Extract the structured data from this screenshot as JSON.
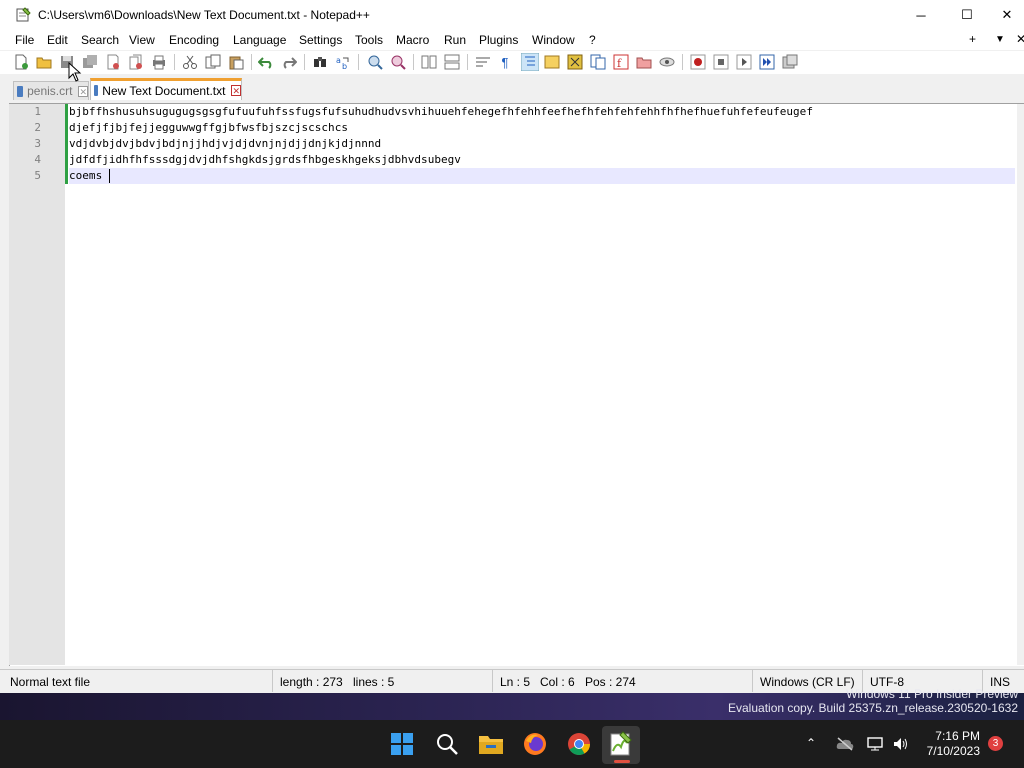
{
  "window": {
    "title": "C:\\Users\\vm6\\Downloads\\New Text Document.txt - Notepad++",
    "minimize_glyph": "─",
    "maximize_glyph": "☐",
    "close_glyph": "✕"
  },
  "menu": {
    "items": [
      "File",
      "Edit",
      "Search",
      "View",
      "Encoding",
      "Language",
      "Settings",
      "Tools",
      "Macro",
      "Run",
      "Plugins",
      "Window",
      "?"
    ],
    "right": [
      "+",
      "▼",
      "✕"
    ]
  },
  "tabs": [
    {
      "label": "penis.crt",
      "active": false
    },
    {
      "label": "New Text Document.txt",
      "active": true
    }
  ],
  "editor": {
    "line_numbers": [
      "1",
      "2",
      "3",
      "4",
      "5"
    ],
    "lines": [
      "bjbffhshusuhsugugugsgsgfufuufuhfssfugsfufsuhudhudvsvhihuuehfehegefhfehhfeefhefhfehfehfehhfhfhefhuefuhfefeufeugef",
      "djefjfjbjfejjegguwwgffgjbfwsfbjszcjscschcs",
      "vdjdvbjdvjbdvjbdjnjjhdjvjdjdvnjnjdjjdnjkjdjnnnd",
      "jdfdfjidhfhfsssdgjdvjdhfshgkdsjgrdsfhbgeskhgeksjdbhvdsubegv",
      "coems"
    ],
    "current_line": 5
  },
  "status": {
    "file_type": "Normal text file",
    "length": "length : 273",
    "lines": "lines : 5",
    "ln": "Ln : 5",
    "col": "Col : 6",
    "pos": "Pos : 274",
    "eol": "Windows (CR LF)",
    "encoding": "UTF-8",
    "mode": "INS"
  },
  "desktop": {
    "watermark_line1": "Windows 11 Pro Insider Preview",
    "watermark_line2": "Evaluation copy. Build 25375.zn_release.230520-1632"
  },
  "taskbar": {
    "apps": [
      "start-icon",
      "search-icon",
      "file-explorer-icon",
      "firefox-icon",
      "chrome-icon",
      "notepadpp-icon"
    ],
    "time": "7:16 PM",
    "date": "7/10/2023",
    "notification_count": "3"
  },
  "colors": {
    "tab_accent": "#f0a030",
    "change_bar": "#2ea043",
    "current_line": "#e8e8ff",
    "taskbar": "#1c1c1c"
  }
}
